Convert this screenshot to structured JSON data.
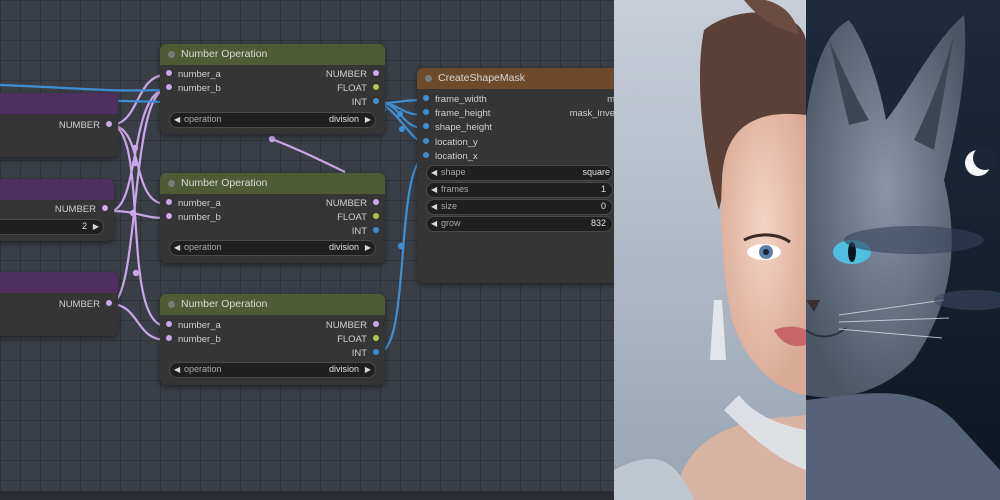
{
  "colors": {
    "canvas_bg": "#3a3f47",
    "number_wire": "#c9a7e8",
    "int_wire": "#3d8fd1",
    "green_header": "#4e5b35",
    "purple_header": "#4e2f60",
    "brown_header": "#6e4a2c"
  },
  "left_nodes": [
    {
      "output_label": "NUMBER"
    },
    {
      "output_label": "NUMBER",
      "widget_value": "2"
    },
    {
      "output_label": "NUMBER"
    }
  ],
  "number_operation_nodes": [
    {
      "title": "Number Operation",
      "input_a": "number_a",
      "input_b": "number_b",
      "out_number": "NUMBER",
      "out_float": "FLOAT",
      "out_int": "INT",
      "widget_label": "operation",
      "widget_value": "division"
    },
    {
      "title": "Number Operation",
      "input_a": "number_a",
      "input_b": "number_b",
      "out_number": "NUMBER",
      "out_float": "FLOAT",
      "out_int": "INT",
      "widget_label": "operation",
      "widget_value": "division"
    },
    {
      "title": "Number Operation",
      "input_a": "number_a",
      "input_b": "number_b",
      "out_number": "NUMBER",
      "out_float": "FLOAT",
      "out_int": "INT",
      "widget_label": "operation",
      "widget_value": "division"
    }
  ],
  "create_shape_mask": {
    "title": "CreateShapeMask",
    "inputs": [
      "frame_width",
      "frame_height",
      "shape_height",
      "location_y",
      "location_x"
    ],
    "out_1": "m",
    "out_2": "mask_inve",
    "widgets": [
      {
        "label": "shape",
        "value": "square"
      },
      {
        "label": "frames",
        "value": "1"
      },
      {
        "label": "size",
        "value": "0"
      },
      {
        "label": "grow",
        "value": "832"
      }
    ]
  },
  "preview_image": {
    "subject_left": "woman-portrait",
    "subject_right": "grey-cat-portrait",
    "moon": "crescent-moon"
  }
}
